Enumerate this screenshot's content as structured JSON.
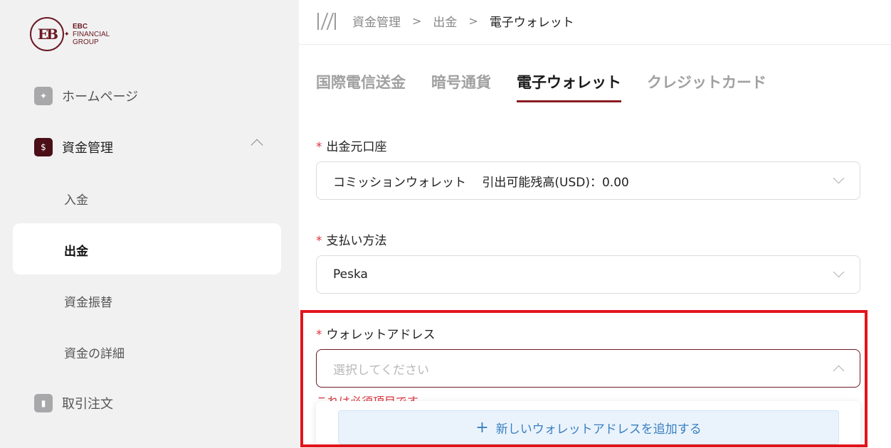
{
  "logo": {
    "line1": "EBC",
    "line2": "FINANCIAL",
    "line3": "GROUP",
    "mark": "EB"
  },
  "sidebar": {
    "items": [
      {
        "label": "ホームページ",
        "icon": "home-icon"
      },
      {
        "label": "資金管理",
        "icon": "funds-icon"
      },
      {
        "label": "取引注文",
        "icon": "chart-icon"
      }
    ],
    "sub_items": [
      {
        "label": "入金"
      },
      {
        "label": "出金"
      },
      {
        "label": "資金振替"
      },
      {
        "label": "資金の詳細"
      }
    ]
  },
  "breadcrumb": [
    "資金管理",
    "出金",
    "電子ウォレット"
  ],
  "tabs": [
    "国際電信送金",
    "暗号通貨",
    "電子ウォレット",
    "クレジットカード"
  ],
  "form": {
    "source_account": {
      "label": "出金元口座",
      "value": "コミッションウォレット　 引出可能残高(USD)：0.00"
    },
    "payment_method": {
      "label": "支払い方法",
      "value": "Peska"
    },
    "wallet_address": {
      "label": "ウォレットアドレス",
      "placeholder": "選択してください",
      "error": "これは必須項目です"
    },
    "add_wallet_label": "新しいウォレットアドレスを追加する"
  },
  "colors": {
    "brand": "#6b1a22",
    "accent_tab": "#8a1c24",
    "error": "#d9363e",
    "highlight": "#e1151b",
    "add_button": "#3a7fc0"
  }
}
